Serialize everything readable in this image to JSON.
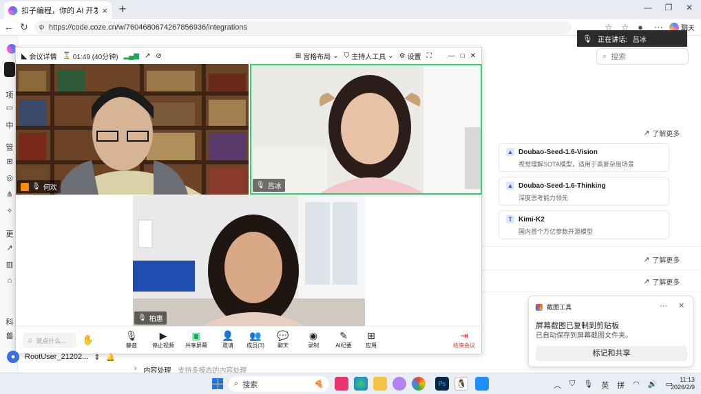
{
  "browser": {
    "tab_title": "扣子编程，你的 AI 开发伙伴。Vib",
    "tab_close": "×",
    "new_tab": "+",
    "url": "https://code.coze.cn/w/7604680674267856936/integrations",
    "chat_label": "聊天"
  },
  "page": {
    "speaking_label": "正在讲话:",
    "speaking_name": "吕冰",
    "search_placeholder": "搜索",
    "learn_more": "了解更多",
    "models": [
      {
        "name": "Doubao-Seed-1.6-Vision",
        "desc": "视觉理解SOTA模型，适用于高复杂度场景"
      },
      {
        "name": "Doubao-Seed-1.6-Thinking",
        "desc": "深度思考能力领先"
      },
      {
        "name": "Kimi-K2",
        "desc": "国内首个万亿参数开源模型"
      }
    ],
    "content_processing": "内容处理",
    "content_processing_desc": "支持多模态的内容处理",
    "user_name": "RootUser_21202...",
    "side_labels": [
      "项",
      "管",
      "更",
      "科",
      "兽"
    ]
  },
  "meeting": {
    "details_label": "会议详情",
    "timer": "01:49 (40分钟)",
    "layout_label": "宫格布局",
    "host_tools_label": "主持人工具",
    "settings_label": "设置",
    "participants": [
      {
        "name": "何欢"
      },
      {
        "name": "吕冰"
      },
      {
        "name": "柏惠"
      }
    ],
    "say_placeholder": "说点什么...",
    "toolbar": [
      {
        "label": "静音",
        "icon": "mic-icon"
      },
      {
        "label": "停止视频",
        "icon": "camera-icon"
      },
      {
        "label": "共享屏幕",
        "icon": "share-screen-icon"
      },
      {
        "label": "邀请",
        "icon": "invite-icon"
      },
      {
        "label": "成员(3)",
        "icon": "members-icon"
      },
      {
        "label": "聊天",
        "icon": "chat-icon"
      },
      {
        "label": "录制",
        "icon": "record-icon"
      },
      {
        "label": "AI纪要",
        "icon": "ai-notes-icon"
      },
      {
        "label": "应用",
        "icon": "apps-icon"
      },
      {
        "label": "结束会议",
        "icon": "end-meeting-icon"
      }
    ]
  },
  "toast": {
    "app_name": "截图工具",
    "title": "屏幕截图已复制到剪贴板",
    "subtitle": "已自动保存到屏幕截图文件夹。",
    "button": "标记和共享"
  },
  "taskbar": {
    "search_placeholder": "搜索",
    "ime_lang": "英",
    "ime_mode": "拼",
    "time": "11:13",
    "date": "2026/2/9"
  }
}
